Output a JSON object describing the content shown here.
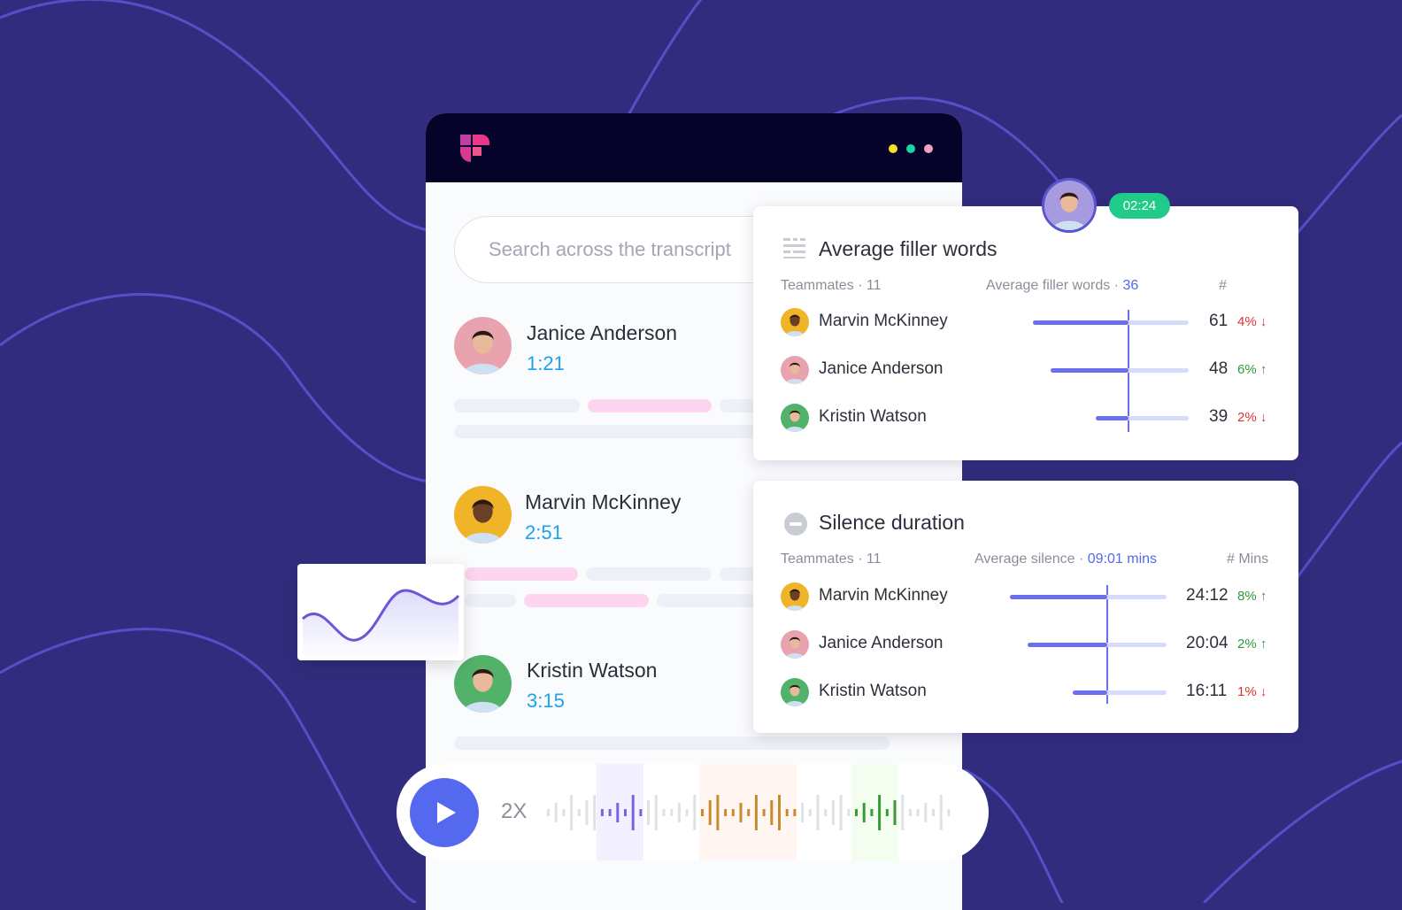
{
  "colors": {
    "background": "#322c7e",
    "accent": "#5469ee",
    "time": "#1ba2ee",
    "up": "#2f9a3a",
    "down": "#e03131",
    "badge": "#20cb8a"
  },
  "window": {
    "dots": [
      "#f5e02a",
      "#1bd3a8",
      "#f3a0c0"
    ]
  },
  "search": {
    "placeholder": "Search across the transcript"
  },
  "speakers": [
    {
      "name": "Janice Anderson",
      "time": "1:21",
      "avatar": "#e8a3ae"
    },
    {
      "name": "Marvin McKinney",
      "time": "2:51",
      "avatar": "#f0b429"
    },
    {
      "name": "Kristin Watson",
      "time": "3:15",
      "avatar": "#52b26a"
    }
  ],
  "player": {
    "speed": "2X",
    "play_icon": "play-icon"
  },
  "call_timer": "02:24",
  "filler": {
    "title": "Average filler words",
    "icon": "list-icon",
    "teammates": "Teammates · 11",
    "avg_label": "Average filler words · ",
    "avg_value": "36",
    "col": "#",
    "average": 36,
    "rows": [
      {
        "name": "Marvin McKinney",
        "value": "61",
        "num": 61,
        "delta": "4%",
        "dir": "down"
      },
      {
        "name": "Janice Anderson",
        "value": "48",
        "num": 48,
        "delta": "6%",
        "dir": "up"
      },
      {
        "name": "Kristin Watson",
        "value": "39",
        "num": 39,
        "delta": "2%",
        "dir": "down"
      }
    ]
  },
  "silence": {
    "title": "Silence duration",
    "icon": "minus-circle-icon",
    "teammates": "Teammates · 11",
    "avg_label": "Average silence · ",
    "avg_value": "09:01 mins",
    "col": "# Mins",
    "rows": [
      {
        "name": "Marvin McKinney",
        "value": "24:12",
        "delta": "8%",
        "dir": "up"
      },
      {
        "name": "Janice Anderson",
        "value": "20:04",
        "delta": "2%",
        "dir": "up"
      },
      {
        "name": "Kristin Watson",
        "value": "16:11",
        "delta": "1%",
        "dir": "down"
      }
    ]
  }
}
